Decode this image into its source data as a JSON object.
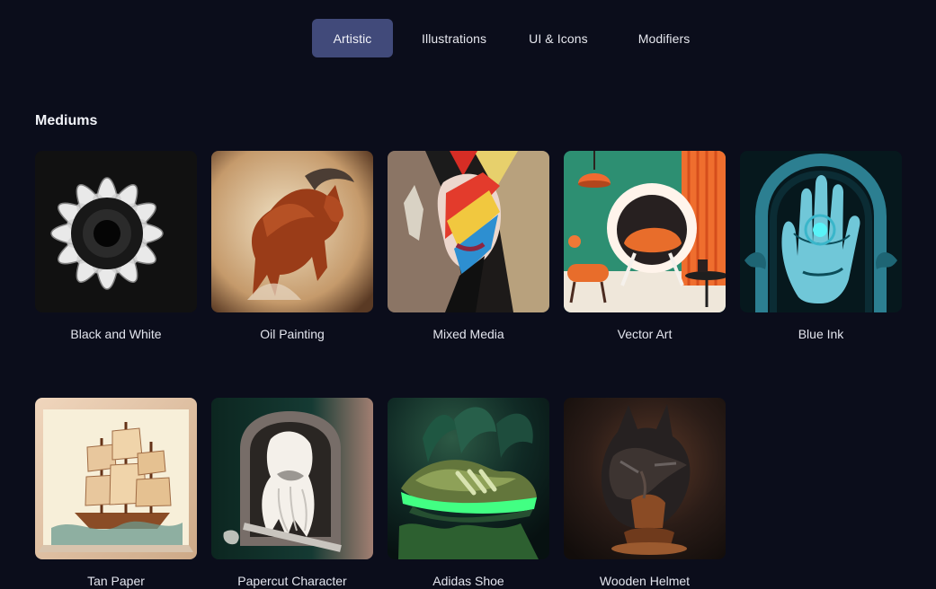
{
  "tabs": [
    {
      "label": "Artistic",
      "active": true
    },
    {
      "label": "Illustrations",
      "active": false
    },
    {
      "label": "UI & Icons",
      "active": false
    },
    {
      "label": "Modifiers",
      "active": false
    }
  ],
  "section": {
    "title": "Mediums"
  },
  "cards": [
    {
      "label": "Black and White",
      "image": "black-and-white-sunflower"
    },
    {
      "label": "Oil Painting",
      "image": "oil-painting-horse"
    },
    {
      "label": "Mixed Media",
      "image": "mixed-media-portrait"
    },
    {
      "label": "Vector Art",
      "image": "vector-art-egg-chair"
    },
    {
      "label": "Blue Ink",
      "image": "blue-ink-hand"
    },
    {
      "label": "Tan Paper",
      "image": "tan-paper-ship"
    },
    {
      "label": "Papercut Character",
      "image": "papercut-bearded-character"
    },
    {
      "label": "Adidas Shoe",
      "image": "adidas-shoe"
    },
    {
      "label": "Wooden Helmet",
      "image": "wooden-helmet"
    }
  ]
}
